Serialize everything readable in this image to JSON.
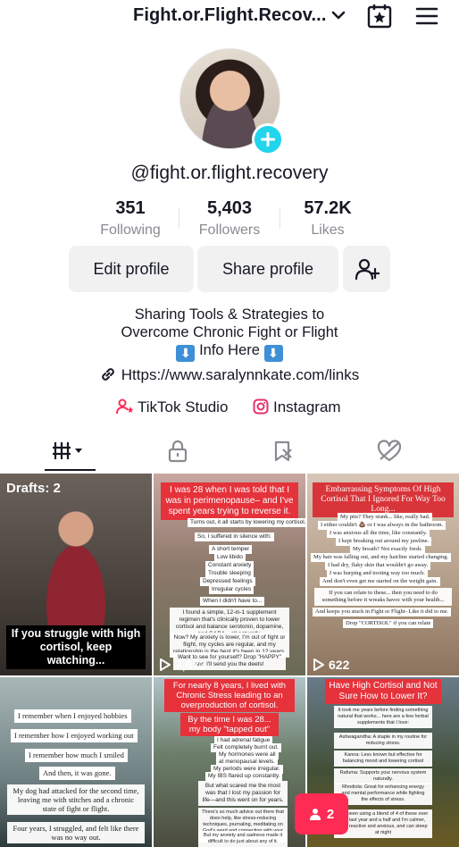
{
  "header": {
    "title": "Fight.or.Flight.Recov...",
    "dropdown_icon": "chevron-down-icon",
    "calendar_icon": "calendar-star-icon",
    "menu_icon": "hamburger-menu-icon"
  },
  "profile": {
    "handle": "@fight.or.flight.recovery",
    "stats": [
      {
        "value": "351",
        "label": "Following"
      },
      {
        "value": "5,403",
        "label": "Followers"
      },
      {
        "value": "57.2K",
        "label": "Likes"
      }
    ],
    "buttons": {
      "edit": "Edit profile",
      "share": "Share profile"
    },
    "bio_line1": "Sharing Tools & Strategies to",
    "bio_line2": "Overcome Chronic Fight or Flight",
    "bio_line3": "Info Here",
    "bio_arrow": "⬇",
    "link": "Https://www.saralynnkate.com/links",
    "studio": "TikTok Studio",
    "instagram": "Instagram"
  },
  "tabs": [
    {
      "icon": "grid-videos-icon",
      "active": true
    },
    {
      "icon": "lock-icon",
      "active": false
    },
    {
      "icon": "bookmark-icon",
      "active": false
    },
    {
      "icon": "heart-hidden-icon",
      "active": false
    }
  ],
  "videos": [
    {
      "drafts": "Drafts: 2",
      "caption": "If you struggle with high cortisol, keep watching..."
    },
    {
      "heading": "I was 28 when I was told that I was in perimenopause– and I've spent years trying to reverse it.",
      "lines": [
        "Turns out, it all starts by lowering my cortisol.",
        "So, I suffered in silence with:",
        "A short temper",
        "Low libido",
        "Constant anxiety",
        "Trouble sleeping",
        "Depressed feelings",
        "Irregular cycles",
        "When I didn't have to...",
        "I found a simple, 12-in-1 supplement regimen that's clinically proven to lower cortisol and balance serotonin, dopamine, and GABA—all naturally.",
        "Now? My anxiety is lower, I'm out of fight or flight, my cycles are regular, and my relationship is the best it's been in 12 years.",
        "Want to see for yourself? Drop \"HAPPY\" and I'll send you the deets!"
      ],
      "views": "7,673"
    },
    {
      "heading": "Embarrassing Symptoms Of High Cortisol That I Ignored For Way Too Long...",
      "lines": [
        "My pits? They stunk... like, really bad.",
        "I either couldn't 💩 or I was always in the bathroom.",
        "I was anxious all the time, like constantly.",
        "I kept breaking out around my jawline.",
        "My breath? Not exactly fresh.",
        "My hair was falling out, and my hairline started changing.",
        "I had dry, flaky skin that wouldn't go away.",
        "I was burping and tooting way too much.",
        "And don't even get me started on the weight gain.",
        "If you can relate to these... then you need to do something before it wreaks havoc with your health...",
        "And keeps you stuck in Fight or Flight- Like it did to me.",
        "Drop \"CORTISOL\" if you can relate"
      ],
      "views": "622"
    },
    {
      "lines": [
        "I remember when I enjoyed hobbies",
        "I remember how I enjoyed working out",
        "I remember how much I smiled",
        "And then, it was gone.",
        "My dog had attacked for the second time, leaving me with stitches and a chronic state of fight or flight.",
        "Four years, I struggled, and felt like there was no way out."
      ]
    },
    {
      "heading": "For nearly 8 years, I lived with Chronic Stress leading to an overproduction of cortisol.",
      "subheading": "By the time I was 28... my body \"tapped out\"",
      "lines": [
        "I had adrenal fatigue",
        "Felt completely burnt out.",
        "My hormones were all",
        "at menopausal levels.",
        "My periods were irregular.",
        "My IBS flared up constantly.",
        "But what scared me the most was that I lost my passion for life—and this went on for years.",
        "There's so much advice out there that does help, like stress-reducing techniques, journaling, meditating on God's word and connecting with your inner child...",
        "But my anxiety and sadness made it difficult to do just about any of it."
      ]
    },
    {
      "heading": "Have High Cortisol and Not Sure How to Lower It?",
      "lines": [
        "It took me years before finding something natural that works... here are a few herbal supplements that I love:",
        "Ashwagandha: A staple in my routine for reducing stress.",
        "Kanna: Less known but effective for balancing mood and lowering cortisol",
        "Rafuma: Supports your nervous system naturally.",
        "Rhodiola: Great for enhancing energy and mental performance while fighting the effects of stress.",
        "I've been using a blend of 4 of these over the last year and a half and I'm calmer, less reactive and anxious, and can sleep at night"
      ]
    }
  ],
  "float_button": {
    "icon": "person-icon",
    "count": "2"
  },
  "colors": {
    "accent": "#fe2c55",
    "cyan": "#20d5ec",
    "text": "#161823",
    "muted": "#8a8b91"
  }
}
